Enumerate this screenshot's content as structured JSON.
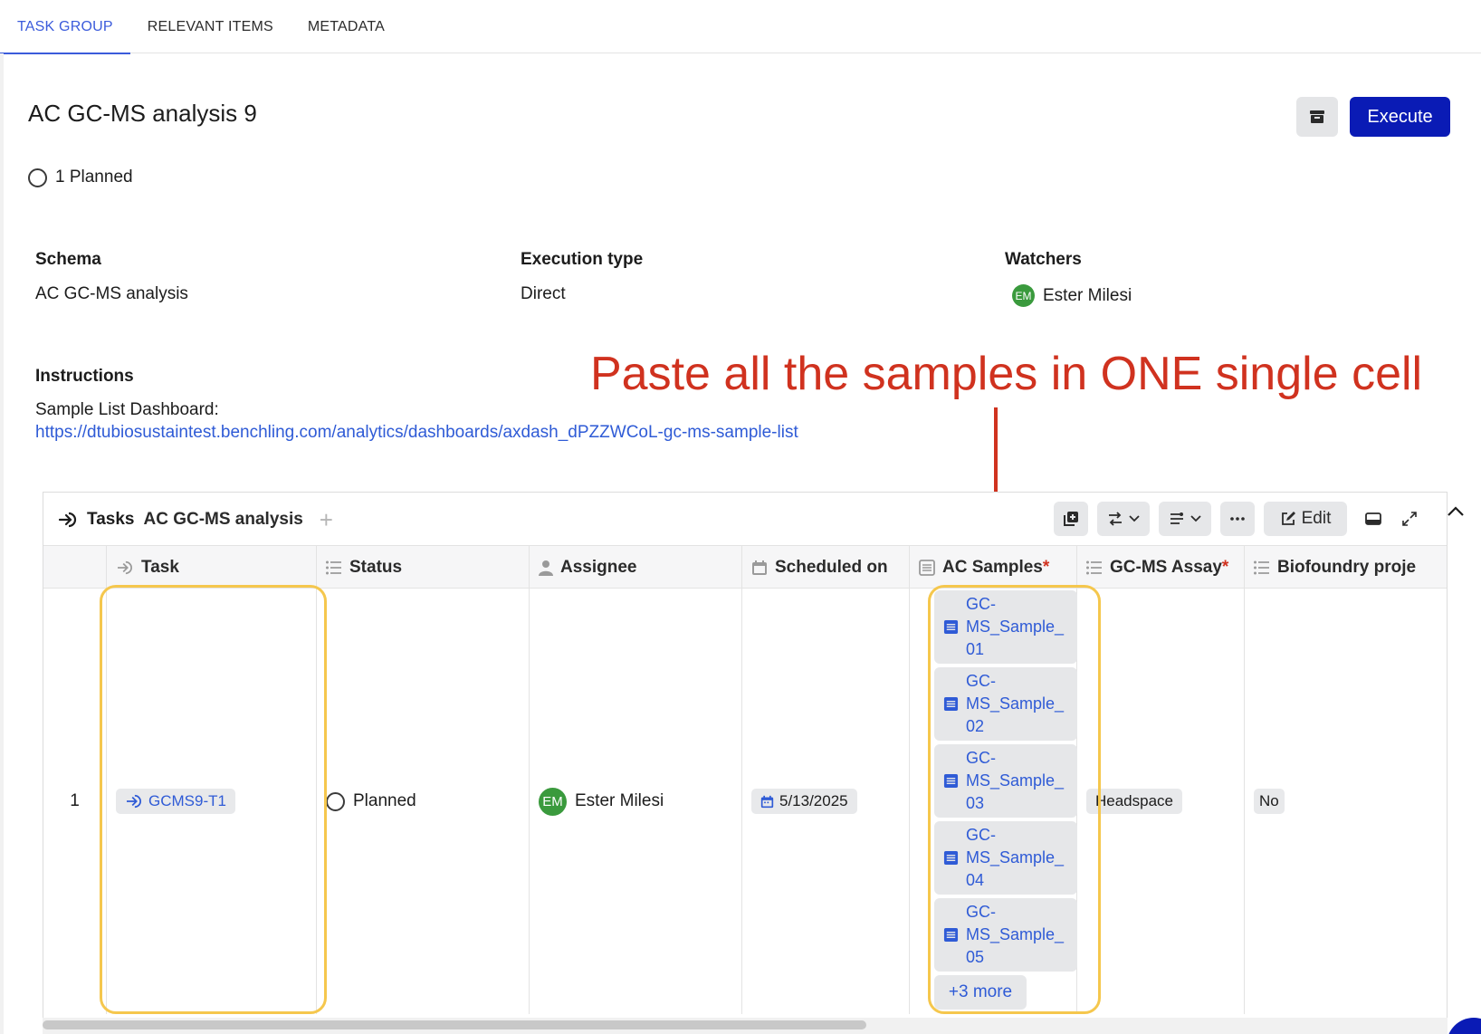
{
  "tabs": [
    {
      "label": "TASK GROUP",
      "active": true
    },
    {
      "label": "RELEVANT ITEMS",
      "active": false
    },
    {
      "label": "METADATA",
      "active": false
    }
  ],
  "header": {
    "title": "AC GC-MS analysis 9",
    "execute_label": "Execute",
    "planned_summary": "1 Planned"
  },
  "fields": {
    "schema_label": "Schema",
    "schema_value": "AC GC-MS analysis",
    "execution_type_label": "Execution type",
    "execution_type_value": "Direct",
    "watchers_label": "Watchers",
    "watcher_initials": "EM",
    "watcher_name": "Ester Milesi",
    "instructions_label": "Instructions",
    "instructions_text": "Sample List Dashboard:",
    "instructions_link": "https://dtubiosustaintest.benchling.com/analytics/dashboards/axdash_dPZZWCoL-gc-ms-sample-list"
  },
  "annotation": {
    "text": "Paste all the samples in ONE single cell"
  },
  "table": {
    "title_label": "Tasks",
    "schema_name": "AC GC-MS analysis",
    "edit_label": "Edit",
    "columns": [
      {
        "label": "Task",
        "required": false,
        "icon": "task-icon"
      },
      {
        "label": "Status",
        "required": false,
        "icon": "list-icon"
      },
      {
        "label": "Assignee",
        "required": false,
        "icon": "person-icon"
      },
      {
        "label": "Scheduled on",
        "required": false,
        "icon": "calendar-icon"
      },
      {
        "label": "AC Samples",
        "required": true,
        "icon": "entity-icon"
      },
      {
        "label": "GC-MS Assay",
        "required": true,
        "icon": "list-icon"
      },
      {
        "label": "Biofoundry proje",
        "required": false,
        "icon": "list-icon"
      }
    ],
    "required_mark": "*",
    "row": {
      "index": "1",
      "task_id": "GCMS9-T1",
      "status": "Planned",
      "assignee_initials": "EM",
      "assignee_name": "Ester Milesi",
      "scheduled_on": "5/13/2025",
      "samples": [
        {
          "line1": "GC-",
          "line2": "MS_Sample_",
          "line3": "01"
        },
        {
          "line1": "GC-",
          "line2": "MS_Sample_",
          "line3": "02"
        },
        {
          "line1": "GC-",
          "line2": "MS_Sample_",
          "line3": "03"
        },
        {
          "line1": "GC-",
          "line2": "MS_Sample_",
          "line3": "04"
        },
        {
          "line1": "GC-",
          "line2": "MS_Sample_",
          "line3": "05"
        }
      ],
      "more_samples": "+3 more",
      "assay": "Headspace",
      "biofoundry": "No"
    }
  },
  "colors": {
    "accent": "#3b5bdb",
    "primary_button": "#0a1bb5",
    "annotation": "#d0321f",
    "highlight": "#f5c74d",
    "avatar": "#3a9a3d"
  }
}
